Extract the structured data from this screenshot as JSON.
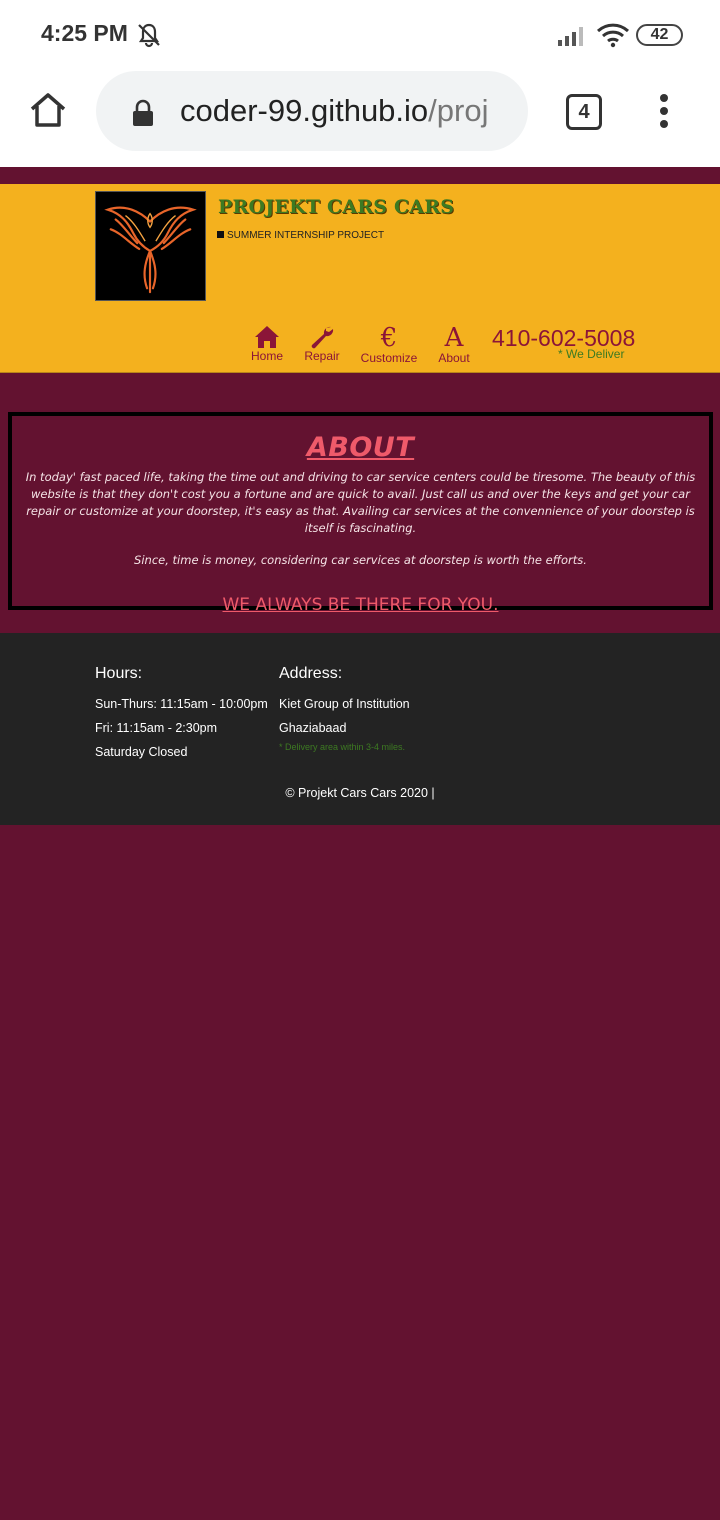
{
  "status_bar": {
    "time": "4:25 PM",
    "battery": "42",
    "bell_icon": "bell-off-icon",
    "signal_icon": "signal-icon",
    "wifi_icon": "wifi-icon"
  },
  "browser": {
    "url_host": "coder-99.github.io",
    "url_path": "/proj",
    "tab_count": "4"
  },
  "header": {
    "title": "PROJEKT CARS CARS",
    "subtitle": "SUMMER INTERNSHIP PROJECT",
    "nav": [
      {
        "label": "Home",
        "icon": "home-icon"
      },
      {
        "label": "Repair",
        "icon": "wrench-icon"
      },
      {
        "label": "Customize",
        "icon": "euro-icon",
        "glyph": "€"
      },
      {
        "label": "About",
        "icon": "font-a-icon",
        "glyph": "A"
      }
    ],
    "phone": "410-602-5008",
    "deliver_note": "* We Deliver"
  },
  "about": {
    "title": "ABOUT",
    "paragraph1": "In today' fast paced life, taking the time out and driving to car service centers could be tiresome. The beauty of this website is that they don't cost you a fortune and are quick to avail. Just call us and over the keys and get your car repair or customize at your doorstep, it's easy as that. Availing car services at the convennience of your doorstep is itself is fascinating.",
    "paragraph2": "Since, time is money, considering car services at doorstep is worth the efforts.",
    "cta": "WE ALWAYS BE THERE FOR YOU."
  },
  "footer": {
    "hours_title": "Hours:",
    "hours": [
      "Sun-Thurs: 11:15am - 10:00pm",
      "Fri: 11:15am - 2:30pm",
      "Saturday Closed"
    ],
    "address_title": "Address:",
    "address": [
      "Kiet Group of Institution",
      "Ghaziabaad"
    ],
    "delivery_note": "* Delivery area within 3-4 miles.",
    "copyright": "© Projekt Cars Cars 2020 |"
  },
  "colors": {
    "page_bg": "#631230",
    "header_bg": "#f4b11e",
    "accent": "#8b1538",
    "cta": "#ef5a6a",
    "footer_bg": "#232323",
    "green": "#3d7a22"
  }
}
